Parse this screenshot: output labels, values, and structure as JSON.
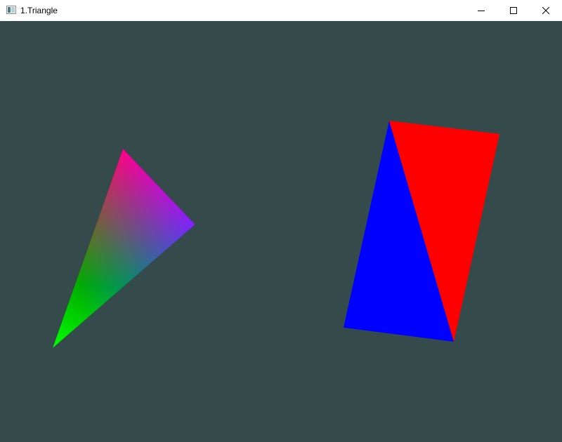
{
  "window": {
    "title": "1.Triangle",
    "icons": {
      "app": "app-window-icon",
      "minimize": "minimize-icon",
      "maximize": "maximize-icon",
      "close": "close-icon"
    }
  },
  "scene": {
    "clear_color": "#354b4b",
    "gradient_triangle": {
      "vertex_colors": [
        "#ff0000",
        "#0000ff",
        "#00ff00"
      ]
    },
    "quad": {
      "left_triangle_color": "#0000ff",
      "right_triangle_color": "#ff0000"
    }
  }
}
